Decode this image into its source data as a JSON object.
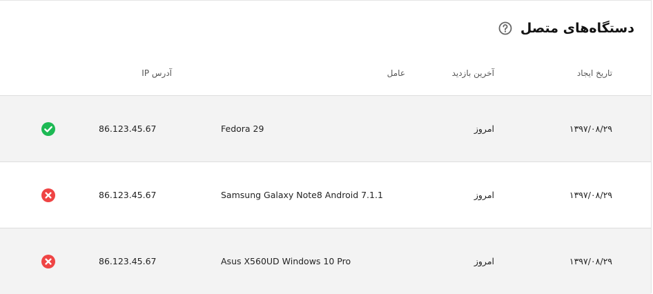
{
  "header": {
    "title": "دستگاه‌های متصل",
    "help_icon": "help-circle-icon"
  },
  "columns": {
    "created": "تاریخ ایجاد",
    "last_visit": "آخرین بازدید",
    "agent": "عامل",
    "ip": "آدرس IP"
  },
  "colors": {
    "success": "#1db954",
    "error": "#ef4444",
    "row_shade": "#f3f3f3",
    "divider": "#dddddd"
  },
  "rows": [
    {
      "created": "۱۳۹۷/۰۸/۲۹",
      "last_visit": "امروز",
      "agent": "Fedora 29",
      "ip": "86.123.45.67",
      "status": "active",
      "status_icon": "check-circle-icon"
    },
    {
      "created": "۱۳۹۷/۰۸/۲۹",
      "last_visit": "امروز",
      "agent": "Samsung Galaxy Note8 Android 7.1.1",
      "ip": "86.123.45.67",
      "status": "inactive",
      "status_icon": "x-circle-icon"
    },
    {
      "created": "۱۳۹۷/۰۸/۲۹",
      "last_visit": "امروز",
      "agent": "Asus X560UD Windows 10 Pro",
      "ip": "86.123.45.67",
      "status": "inactive",
      "status_icon": "x-circle-icon"
    }
  ]
}
